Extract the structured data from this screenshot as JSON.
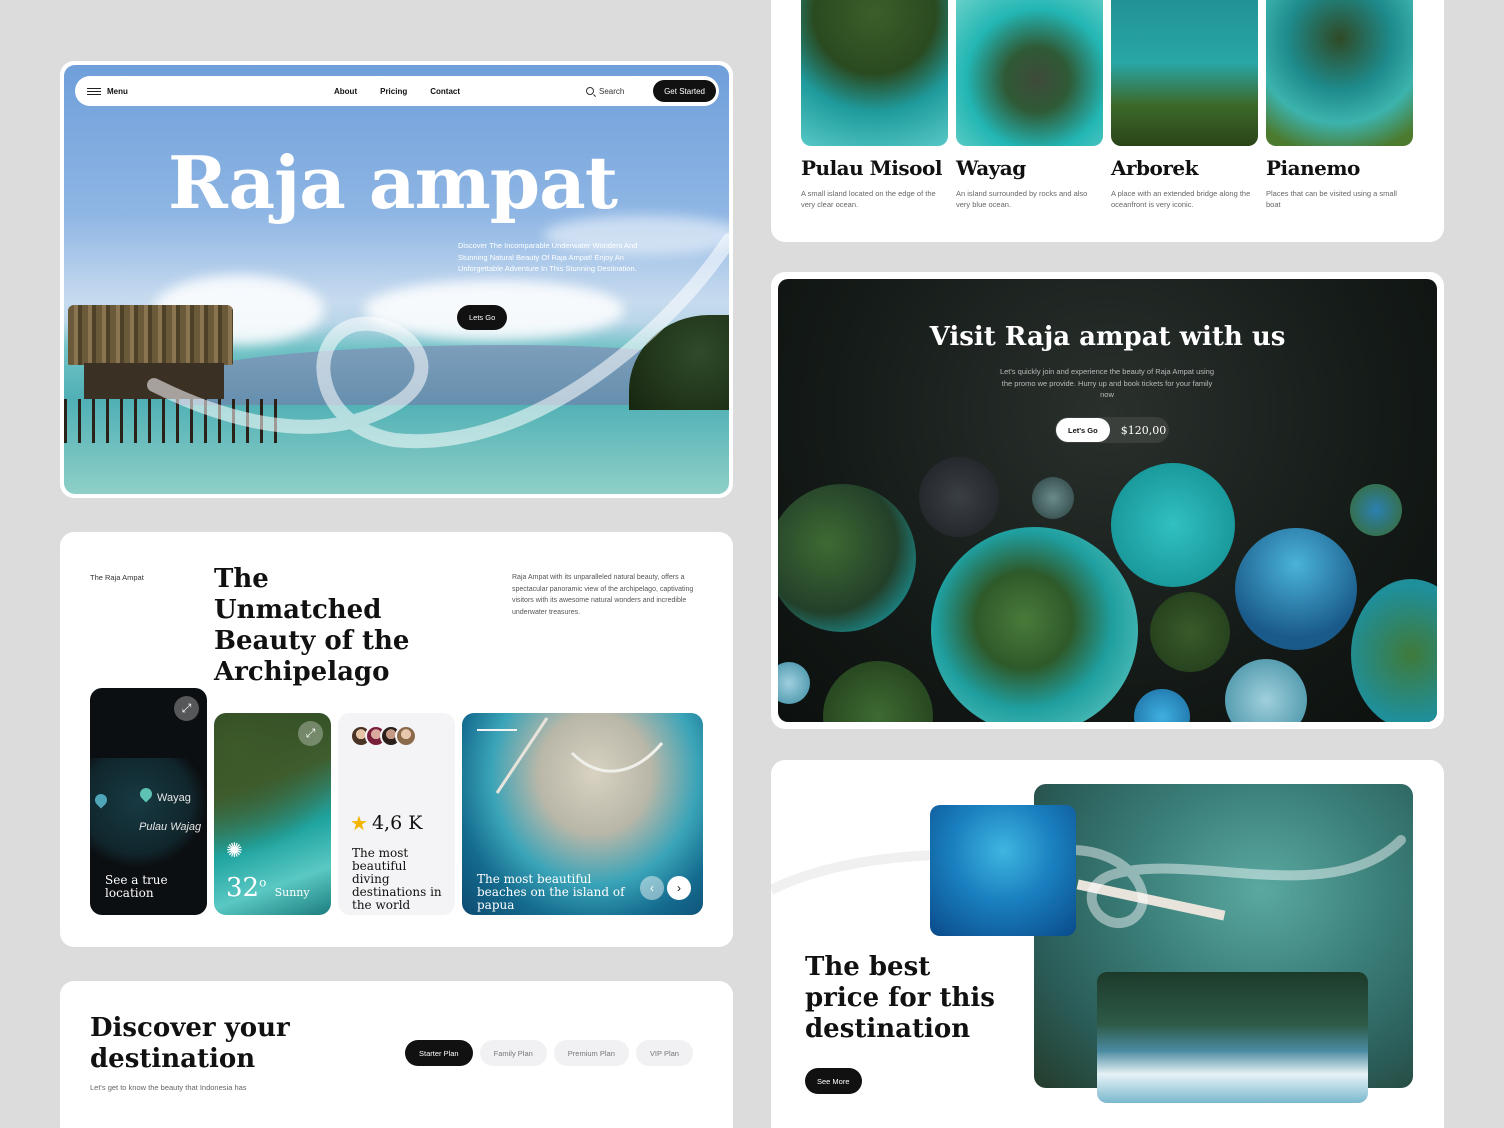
{
  "hero": {
    "nav": {
      "menu_label": "Menu",
      "links": [
        "About",
        "Pricing",
        "Contact"
      ],
      "search_label": "Search",
      "cta_label": "Get Started"
    },
    "title": "Raja ampat",
    "description": "Discover The Incomparable Underwater Wonders And Stunning Natural Beauty Of Raja Ampat! Enjoy An Unforgettable Adventure In This Stunning Destination.",
    "button_label": "Lets Go"
  },
  "beauty": {
    "tag": "The Raja Ampat",
    "title": "The Unmatched Beauty of the Archipelago",
    "description": "Raja Ampat with its unparalleled natural beauty, offers a spectacular panoramic view of the archipelago, captivating visitors with its awesome natural wonders and incredible underwater treasures.",
    "map_card": {
      "pin_1": "Wayag",
      "pin_2": "Pulau Wajag",
      "caption": "See a true location"
    },
    "weather_card": {
      "temperature": "32",
      "degree": "o",
      "condition": "Sunny"
    },
    "rating_card": {
      "value": "4,6 K",
      "caption": "The most beautiful diving destinations in the world"
    },
    "beach_card": {
      "caption": "The most beautiful beaches on the island of papua"
    }
  },
  "discover": {
    "title": "Discover your destination",
    "subtitle": "Let's get to know the beauty that Indonesia has",
    "plans": [
      "Starter Plan",
      "Family Plan",
      "Premium Plan",
      "VIP Plan"
    ],
    "active_plan": "Starter Plan"
  },
  "islands": [
    {
      "name": "Pulau Misool",
      "description": "A small island located on the edge of the very clear ocean."
    },
    {
      "name": "Wayag",
      "description": "An island surrounded by rocks and also very blue ocean."
    },
    {
      "name": "Arborek",
      "description": "A place with an extended bridge along the oceanfront is very iconic."
    },
    {
      "name": "Pianemo",
      "description": "Places that can be visited using a small boat"
    }
  ],
  "visit": {
    "title": "Visit Raja ampat with us",
    "description": "Let's quickly join and experience the beauty of Raja Ampat using the promo we provide. Hurry up and book tickets for your family now",
    "button_label": "Let's Go",
    "price": "$120,00"
  },
  "best_price": {
    "title": "The best price for this destination",
    "button_label": "See More"
  },
  "colors": {
    "dark": "#111111",
    "accent_teal": "#1fa4a0",
    "star": "#f4b400"
  },
  "icons": [
    "hamburger-icon",
    "search-icon",
    "expand-icon",
    "location-pin-icon",
    "sun-icon",
    "star-icon",
    "chevron-left-icon",
    "chevron-right-icon"
  ]
}
